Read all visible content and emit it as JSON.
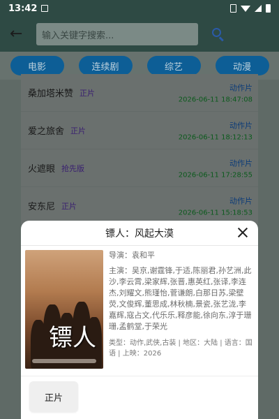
{
  "status": {
    "time": "13:42"
  },
  "search": {
    "placeholder": "输入关键字搜索..."
  },
  "tabs": [
    {
      "label": "电影"
    },
    {
      "label": "连续剧"
    },
    {
      "label": "综艺"
    },
    {
      "label": "动漫"
    }
  ],
  "list": [
    {
      "title": "桑加塔米赞",
      "badge": "正片",
      "genre": "动作片",
      "time": "2026-06-11 18:47:08"
    },
    {
      "title": "爱之旅舍",
      "badge": "正片",
      "genre": "动作片",
      "time": "2026-06-11 18:12:13"
    },
    {
      "title": "火遮眼",
      "badge": "抢先版",
      "genre": "动作片",
      "time": "2026-06-11 17:28:55"
    },
    {
      "title": "安东尼",
      "badge": "正片",
      "genre": "动作片",
      "time": "2026-06-11 15:18:53"
    }
  ],
  "sheet": {
    "title": "镖人：风起大漠",
    "poster_text": "镖人",
    "director": "导演：袁和平",
    "cast": "主演：吴京,谢霆锋,于适,陈丽君,孙艺洲,此沙,李云霄,梁家辉,张晋,惠英红,张译,李连杰,刘耀文,熊瑾怡,菅谦朗,白那日苏,梁壁荧,文俊辉,董思成,林秋楠,景瓷,张艺泷,李嘉辉,寇占文,代乐乐,释彦能,徐向东,淳于珊珊,孟鹤堂,于荣光",
    "meta": "类型：动作,武侠,古装 | 地区：大陆 | 语言：国语 | 上映：2026",
    "play_label": "正片"
  }
}
